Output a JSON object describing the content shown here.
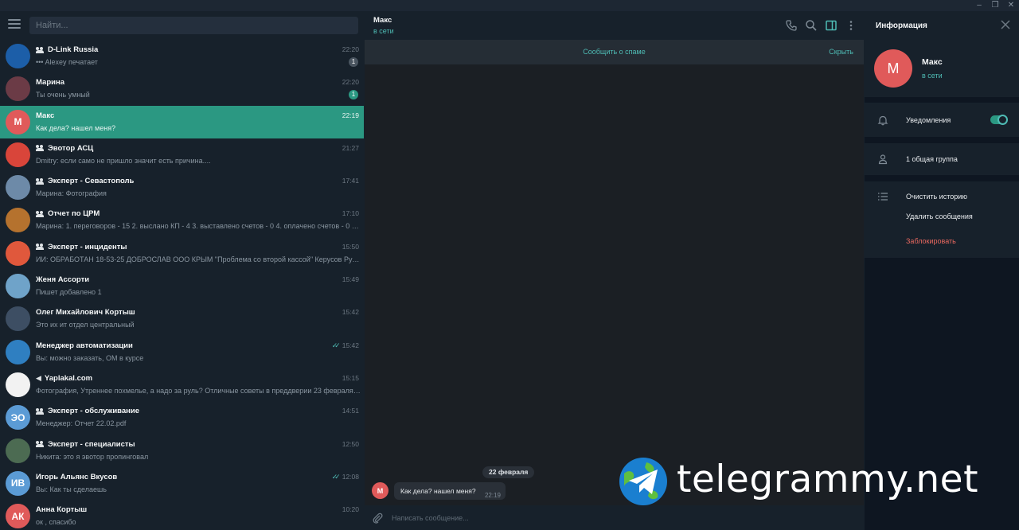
{
  "window": {
    "controls": {
      "minimize": "–",
      "maximize": "❐",
      "close": "✕"
    }
  },
  "search": {
    "placeholder": "Найти..."
  },
  "chats": [
    {
      "name": "D-Link Russia",
      "type": "group",
      "message": "••• Alexey печатает",
      "time": "22:20",
      "badge": "1",
      "badge_style": "muted",
      "avatar_text": "",
      "avatar_color": "#1c5ea8"
    },
    {
      "name": "Марина",
      "type": "user",
      "message": "Ты очень умный",
      "time": "22:20",
      "badge": "1",
      "badge_style": "on",
      "avatar_text": "",
      "avatar_color": "#6b3b46"
    },
    {
      "name": "Макс",
      "type": "user",
      "message": "Как дела? нашел меня?",
      "time": "22:19",
      "badge": "",
      "avatar_text": "M",
      "avatar_color": "#e05a5a",
      "active": true
    },
    {
      "name": "Эвотор АСЦ",
      "type": "group",
      "message": "Dmitry: если само не пришло значит есть причина....",
      "time": "21:27",
      "badge": "",
      "avatar_text": "",
      "avatar_color": "#d9453a"
    },
    {
      "name": "Эксперт - Севастополь",
      "type": "group",
      "message": "Марина: Фотография",
      "time": "17:41",
      "badge": "",
      "avatar_text": "",
      "avatar_color": "#6d8aa8"
    },
    {
      "name": "Отчет по ЦРМ",
      "type": "group",
      "message": "Марина: 1. переговоров - 15 2. выслано КП - 4 3. выставлено счетов - 0 4. оплачено счетов - 0 5. о...",
      "time": "17:10",
      "badge": "",
      "avatar_text": "",
      "avatar_color": "#b5722e"
    },
    {
      "name": "Эксперт - инциденты",
      "type": "group",
      "message": "ИИ: ОБРАБОТАН 18-53-25 ДОБРОСЛАВ ООО КРЫМ \"Проблема со второй кассой\" Керусов Руслан...",
      "time": "15:50",
      "badge": "",
      "avatar_text": "",
      "avatar_color": "#e0583c"
    },
    {
      "name": "Женя Ассорти",
      "type": "user",
      "message": "Пишет добавлено 1",
      "time": "15:49",
      "badge": "",
      "avatar_text": "",
      "avatar_color": "#6fa3c9"
    },
    {
      "name": "Олег Михайлович Кортыш",
      "type": "user",
      "message": "Это их ит отдел центральный",
      "time": "15:42",
      "badge": "",
      "avatar_text": "",
      "avatar_color": "#3d4e63"
    },
    {
      "name": "Менеджер автоматизации",
      "type": "user",
      "message": "Вы: можно заказать, ОМ в курсе",
      "time": "15:42",
      "badge": "",
      "read": true,
      "avatar_text": "",
      "avatar_color": "#2f7fc1"
    },
    {
      "name": "Yaplakal.com",
      "type": "channel",
      "message": "Фотография, Утреннее похмелье, а надо за руль? Отличные советы в преддверии 23 февраля. ...",
      "time": "15:15",
      "badge": "",
      "avatar_text": "",
      "avatar_color": "#f2f2f2"
    },
    {
      "name": "Эксперт - обслуживание",
      "type": "group",
      "message": "Менеджер: Отчет 22.02.pdf",
      "time": "14:51",
      "badge": "",
      "avatar_text": "ЭО",
      "avatar_color": "#5b9bd5"
    },
    {
      "name": "Эксперт - специалисты",
      "type": "group",
      "message": "Никита: это я эвотор пропинговал",
      "time": "12:50",
      "badge": "",
      "avatar_text": "",
      "avatar_color": "#4c6b52"
    },
    {
      "name": "Игорь Альянс Вкусов",
      "type": "user",
      "message": "Вы: Как ты сделаешь",
      "time": "12:08",
      "badge": "",
      "read": true,
      "avatar_text": "ИВ",
      "avatar_color": "#5b9bd5"
    },
    {
      "name": "Анна Кортыш",
      "type": "user",
      "message": "ок , спасибо",
      "time": "10:20",
      "badge": "",
      "avatar_text": "АК",
      "avatar_color": "#e05a5a"
    }
  ],
  "conversation": {
    "title": "Макс",
    "status": "в сети",
    "spam_link": "Сообщить о спаме",
    "hide_link": "Скрыть",
    "date": "22 февраля",
    "message": {
      "avatar": "M",
      "text": "Как дела? нашел меня?",
      "time": "22:19"
    },
    "compose_placeholder": "Написать сообщение..."
  },
  "info_panel": {
    "title": "Информация",
    "avatar": "M",
    "name": "Макс",
    "status": "в сети",
    "notifications_label": "Уведомления",
    "notifications_on": true,
    "groups_label": "1 общая группа",
    "clear_history": "Очистить историю",
    "delete_messages": "Удалить сообщения",
    "block": "Заблокировать"
  },
  "watermark": {
    "text": "telegrammy.net"
  },
  "colors": {
    "accent": "#4fbcb5",
    "active_chat": "#2b9882",
    "danger": "#e8685f"
  }
}
